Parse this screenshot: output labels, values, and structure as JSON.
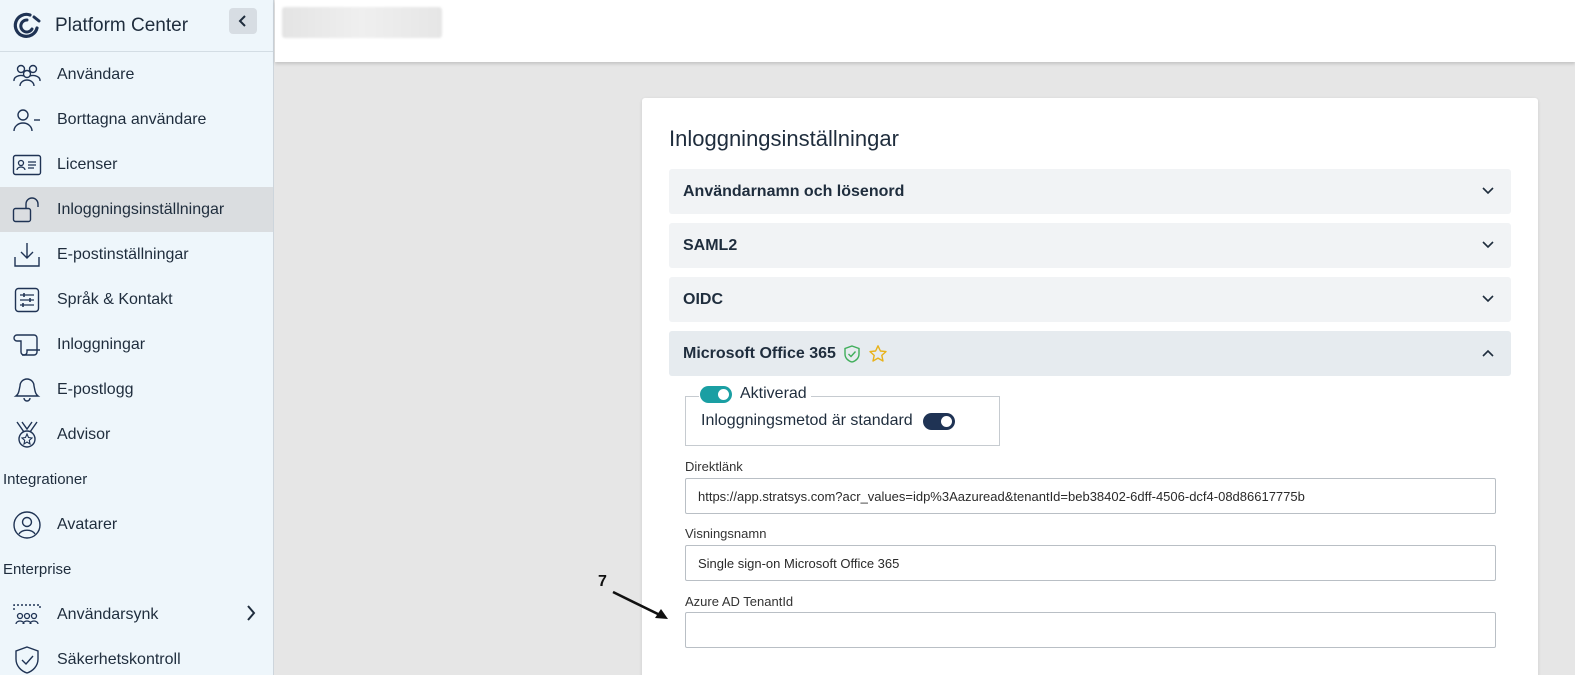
{
  "app": {
    "title": "Platform Center"
  },
  "sidebar": {
    "items": [
      {
        "label": "Användare",
        "icon": "users-icon"
      },
      {
        "label": "Borttagna användare",
        "icon": "user-minus-icon"
      },
      {
        "label": "Licenser",
        "icon": "id-card-icon"
      },
      {
        "label": "Inloggningsinställningar",
        "icon": "unlock-icon"
      },
      {
        "label": "E-postinställningar",
        "icon": "download-tray-icon"
      },
      {
        "label": "Språk & Kontakt",
        "icon": "sliders-icon"
      },
      {
        "label": "Inloggningar",
        "icon": "scroll-icon"
      },
      {
        "label": "E-postlogg",
        "icon": "bell-icon"
      },
      {
        "label": "Advisor",
        "icon": "medal-icon"
      }
    ],
    "section_integrations": "Integrationer",
    "integration_items": [
      {
        "label": "Avatarer",
        "icon": "user-circle-icon"
      }
    ],
    "section_enterprise": "Enterprise",
    "enterprise_items": [
      {
        "label": "Användarsynk",
        "icon": "sync-users-icon"
      },
      {
        "label": "Säkerhetskontroll",
        "icon": "shield-check-icon"
      }
    ]
  },
  "main": {
    "title": "Inloggningsinställningar",
    "sections": [
      {
        "label": "Användarnamn och lösenord"
      },
      {
        "label": "SAML2"
      },
      {
        "label": "OIDC"
      },
      {
        "label": "Microsoft Office 365"
      }
    ],
    "ms365": {
      "enabled_label": "Aktiverad",
      "enabled": true,
      "default_label": "Inloggningsmetod är standard",
      "is_default": true,
      "direct_link_label": "Direktlänk",
      "direct_link_value": "https://app.stratsys.com?acr_values=idp%3Aazuread&tenantId=beb38402-6dff-4506-dcf4-08d86617775b",
      "display_name_label": "Visningsnamn",
      "display_name_value": "Single sign-on Microsoft Office 365",
      "tenant_label": "Azure AD TenantId",
      "tenant_value": ""
    }
  },
  "annotation": {
    "number": "7"
  },
  "colors": {
    "accent_teal": "#1a9fa3",
    "navy": "#1f3354",
    "shield_green": "#3fae5a",
    "star_yellow": "#e8b21a"
  }
}
